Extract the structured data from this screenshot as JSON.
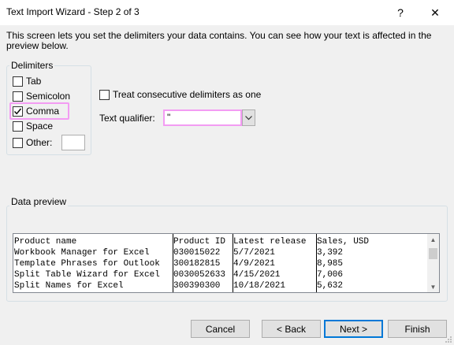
{
  "window": {
    "title": "Text Import Wizard - Step 2 of 3",
    "help_glyph": "?",
    "close_glyph": "✕"
  },
  "description": "This screen lets you set the delimiters your data contains.  You can see how your text is affected in the preview below.",
  "delimiters": {
    "legend": "Delimiters",
    "options": [
      {
        "label": "Tab",
        "checked": false
      },
      {
        "label": "Semicolon",
        "checked": false
      },
      {
        "label": "Comma",
        "checked": true
      },
      {
        "label": "Space",
        "checked": false
      },
      {
        "label": "Other:",
        "checked": false
      }
    ],
    "other_value": ""
  },
  "treat_consecutive": {
    "label": "Treat consecutive delimiters as one",
    "checked": false
  },
  "text_qualifier": {
    "label": "Text qualifier:",
    "value": "\""
  },
  "preview": {
    "legend": "Data preview",
    "rows": [
      [
        "Product name",
        "Product ID",
        "Latest release",
        "Sales, USD"
      ],
      [
        "Workbook Manager for Excel",
        "030015022",
        "5/7/2021",
        "3,392"
      ],
      [
        "Template Phrases for Outlook",
        "300182815",
        "4/9/2021",
        "8,985"
      ],
      [
        "Split Table Wizard for Excel",
        "0030052633",
        "4/15/2021",
        "7,006"
      ],
      [
        "Split Names for Excel",
        "300390300",
        "10/18/2021",
        "5,632"
      ]
    ]
  },
  "buttons": {
    "cancel": "Cancel",
    "back": "< Back",
    "next": "Next >",
    "finish": "Finish"
  },
  "colors": {
    "highlight": "#f39cf3",
    "default_button_border": "#0078d7"
  }
}
